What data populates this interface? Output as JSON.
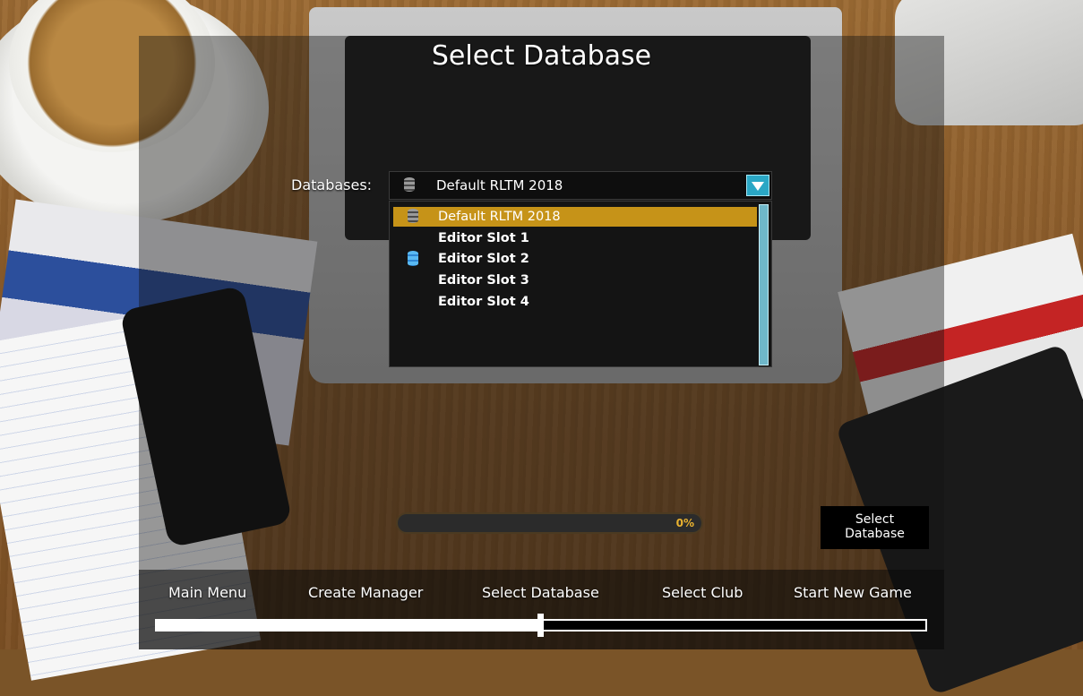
{
  "title": "Select Database",
  "databases_label": "Databases:",
  "selected_database": "Default RLTM 2018",
  "database_options": [
    {
      "label": "Default RLTM 2018",
      "icon": "database-icon-grey",
      "selected": true
    },
    {
      "label": "Editor Slot 1",
      "icon": null,
      "selected": false
    },
    {
      "label": "Editor Slot 2",
      "icon": "database-icon-blue",
      "selected": false
    },
    {
      "label": "Editor Slot 3",
      "icon": null,
      "selected": false
    },
    {
      "label": "Editor Slot 4",
      "icon": null,
      "selected": false
    }
  ],
  "progress": {
    "value": 0,
    "label": "0%"
  },
  "select_button": {
    "line1": "Select",
    "line2": "Database"
  },
  "steps": [
    {
      "label": "Main Menu"
    },
    {
      "label": "Create Manager"
    },
    {
      "label": "Select Database"
    },
    {
      "label": "Select Club"
    },
    {
      "label": "Start New Game"
    }
  ],
  "current_step_index": 2,
  "step_progress_fraction": 0.5,
  "colors": {
    "highlight": "#c69318",
    "accent": "#2aa7c5",
    "progress_text": "#e9b230"
  }
}
